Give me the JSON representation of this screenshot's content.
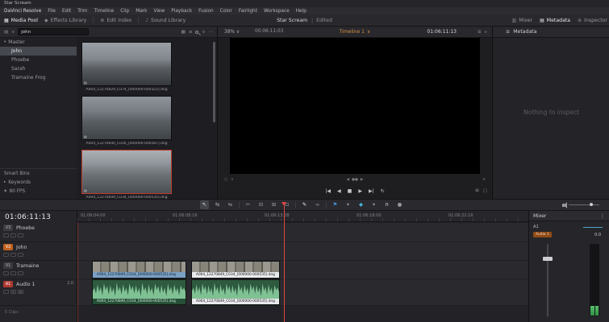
{
  "titlebar": {
    "title": "Star Scream"
  },
  "menubar": {
    "items": [
      "DaVinci Resolve",
      "File",
      "Edit",
      "Trim",
      "Timeline",
      "Clip",
      "Mark",
      "View",
      "Playback",
      "Fusion",
      "Color",
      "Fairlight",
      "Workspace",
      "Help"
    ]
  },
  "toolbar": {
    "media_pool": "Media Pool",
    "effects_library": "Effects Library",
    "edit_index": "Edit Index",
    "sound_library": "Sound Library",
    "project_title": "Star Scream",
    "project_status": "Edited",
    "mixer": "Mixer",
    "metadata": "Metadata",
    "inspector": "Inspector"
  },
  "media_pool": {
    "search_value": "john",
    "bin_root": "Master",
    "bins": [
      {
        "label": "John"
      },
      {
        "label": "Phoebe"
      },
      {
        "label": "Sarah"
      },
      {
        "label": "Tramaine Frog"
      }
    ],
    "clips": [
      {
        "filename": "A004_12270829_C074_[000000-000322].dng"
      },
      {
        "filename": "A004_12270840_C026_[000000-000587].dng"
      },
      {
        "filename": "A004_12270849_C034_[000000-000535].dng"
      }
    ],
    "smart_bins_title": "Smart Bins",
    "smart_bins": [
      {
        "label": "Keywords"
      },
      {
        "label": "80 FPS"
      }
    ]
  },
  "viewer": {
    "zoom": "38%",
    "duration_timecode": "00:06:11:03",
    "timeline_name": "Timeline 1",
    "timecode": "01:06:11:13"
  },
  "inspector": {
    "header": "Metadata",
    "empty_message": "Nothing to inspect"
  },
  "timeline": {
    "timecode": "01:06:11:13",
    "ruler_labels": [
      "01:06:04:00",
      "01:06:08:16",
      "01:06:13:08",
      "01:06:18:00",
      "01:06:22:16"
    ],
    "tracks": [
      {
        "badge": "V3",
        "name": "Phoebe"
      },
      {
        "badge": "V2",
        "name": "John"
      },
      {
        "badge": "V1",
        "name": "Tramaine"
      },
      {
        "badge": "A1",
        "name": "Audio 1",
        "channels": "2.0"
      }
    ],
    "solo": "S",
    "mute": "M",
    "footer": "5 Clips",
    "clips": {
      "video_label": "A004_12270849_C034_[000000-000535].dng",
      "audio_label": "A004_12270849_C034_[000000-000535].dng"
    }
  },
  "mixer": {
    "header": "Mixer",
    "strip_label": "A1",
    "bus_label": "Audio 1",
    "level": "0.0"
  },
  "icons": {
    "media_pool": "▦",
    "effects": "◆",
    "index": "≣",
    "sound": "♪",
    "mixer": "▥",
    "metadata": "▤",
    "inspector": "⊕",
    "chevron_down": "∨",
    "chevron_right": "▸",
    "expand": "▾",
    "more": "⋯",
    "kebab": "⋮",
    "thumb_view": "▦",
    "list_view": "≡",
    "film": "▤",
    "tag": "◈",
    "step_back": "|◀",
    "prev": "◀",
    "stop": "■",
    "play": "▶",
    "step_fwd": "▶|",
    "loop": "↻",
    "box": "▢",
    "grid": "⊞",
    "select": "↖",
    "trim": "↹",
    "swap": "⇆",
    "razor": "✂",
    "insert": "⊟",
    "overwrite": "⊞",
    "replace": "⊡",
    "pen": "✎",
    "link": "∞",
    "flag": "⚑",
    "marker": "◆",
    "snap": "∩",
    "dot": "●",
    "jog": "●●"
  }
}
